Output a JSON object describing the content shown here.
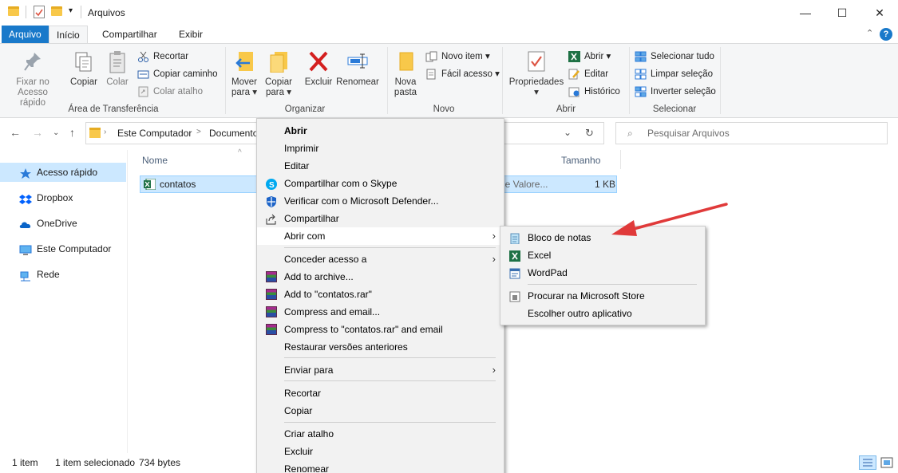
{
  "window": {
    "title": "Arquivos"
  },
  "window_controls": {
    "minimize": "—",
    "maximize": "☐",
    "close": "✕"
  },
  "tabs": [
    {
      "label": "Arquivo"
    },
    {
      "label": "Início"
    },
    {
      "label": "Compartilhar"
    },
    {
      "label": "Exibir"
    }
  ],
  "ribbon": {
    "clipboard": {
      "group_label": "Área de Transferência",
      "pin_label_1": "Fixar no",
      "pin_label_2": "Acesso rápido",
      "copy_label": "Copiar",
      "paste_label": "Colar",
      "cut_label": "Recortar",
      "copy_path_label": "Copiar caminho",
      "paste_shortcut_label": "Colar atalho"
    },
    "organize": {
      "group_label": "Organizar",
      "move_to_label_1": "Mover",
      "move_to_label_2": "para",
      "copy_to_label_1": "Copiar",
      "copy_to_label_2": "para",
      "delete_label": "Excluir",
      "rename_label": "Renomear"
    },
    "new": {
      "group_label": "Novo",
      "new_folder_label_1": "Nova",
      "new_folder_label_2": "pasta",
      "new_item_label": "Novo item",
      "easy_access_label": "Fácil acesso"
    },
    "open": {
      "group_label": "Abrir",
      "properties_label": "Propriedades",
      "open_label": "Abrir",
      "edit_label": "Editar",
      "history_label": "Histórico"
    },
    "select": {
      "group_label": "Selecionar",
      "select_all_label": "Selecionar tudo",
      "select_none_label": "Limpar seleção",
      "invert_label": "Inverter seleção"
    }
  },
  "address": {
    "path_1": "Este Computador",
    "path_sep": ">",
    "path_2": "Documento",
    "search_placeholder": "Pesquisar Arquivos"
  },
  "nav": {
    "items": [
      {
        "label": "Acesso rápido"
      },
      {
        "label": "Dropbox"
      },
      {
        "label": "OneDrive"
      },
      {
        "label": "Este Computador"
      },
      {
        "label": "Rede"
      }
    ]
  },
  "filelist": {
    "col_name": "Nome",
    "col_size": "Tamanho",
    "file": {
      "name": "contatos",
      "type_partial": "de Valore...",
      "size": "1 KB"
    }
  },
  "status": {
    "count": "1 item",
    "selected": "1 item selecionado",
    "size": "734 bytes"
  },
  "context_menu": {
    "items": [
      {
        "label": "Abrir"
      },
      {
        "label": "Imprimir"
      },
      {
        "label": "Editar"
      },
      {
        "label": "Compartilhar com o Skype"
      },
      {
        "label": "Verificar com o Microsoft Defender..."
      },
      {
        "label": "Compartilhar"
      },
      {
        "label": "Abrir com"
      },
      {
        "label": "Conceder acesso a"
      },
      {
        "label": "Add to archive..."
      },
      {
        "label": "Add to \"contatos.rar\""
      },
      {
        "label": "Compress and email..."
      },
      {
        "label": "Compress to \"contatos.rar\" and email"
      },
      {
        "label": "Restaurar versões anteriores"
      },
      {
        "label": "Enviar para"
      },
      {
        "label": "Recortar"
      },
      {
        "label": "Copiar"
      },
      {
        "label": "Criar atalho"
      },
      {
        "label": "Excluir"
      },
      {
        "label": "Renomear"
      }
    ]
  },
  "submenu": {
    "items": [
      {
        "label": "Bloco de notas"
      },
      {
        "label": "Excel"
      },
      {
        "label": "WordPad"
      },
      {
        "label": "Procurar na Microsoft Store"
      },
      {
        "label": "Escolher outro aplicativo"
      }
    ]
  },
  "colors": {
    "accent": "#1979ca",
    "selection": "#cce8ff",
    "annotation_arrow": "#e03a3a",
    "excel_green": "#1e7145"
  }
}
